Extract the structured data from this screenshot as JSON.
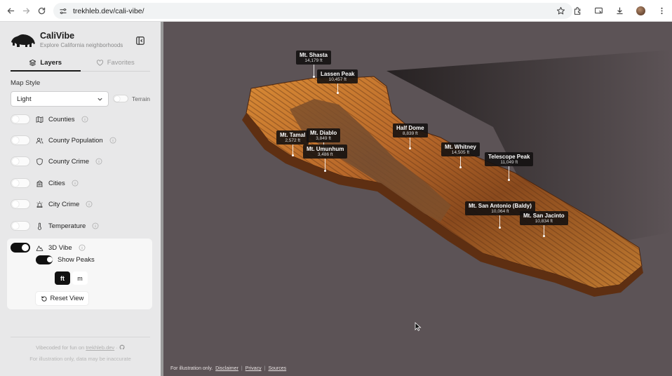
{
  "browser": {
    "url": "trekhleb.dev/cali-vibe/"
  },
  "app": {
    "title": "CaliVibe",
    "subtitle": "Explore California neighborhoods"
  },
  "tabs": [
    {
      "label": "Layers",
      "icon": "layers-icon",
      "active": true
    },
    {
      "label": "Favorites",
      "icon": "heart-icon",
      "active": false
    }
  ],
  "map_style": {
    "label": "Map Style",
    "selected": "Light",
    "terrain_label": "Terrain",
    "terrain_on": false
  },
  "layers": [
    {
      "label": "Counties",
      "icon": "map-icon",
      "on": false
    },
    {
      "label": "County Population",
      "icon": "users-icon",
      "on": false
    },
    {
      "label": "County Crime",
      "icon": "shield-icon",
      "on": false
    },
    {
      "label": "Cities",
      "icon": "building-icon",
      "on": false
    },
    {
      "label": "City Crime",
      "icon": "siren-icon",
      "on": false
    },
    {
      "label": "Temperature",
      "icon": "thermometer-icon",
      "on": false
    },
    {
      "label": "3D Vibe",
      "icon": "mountain-icon",
      "on": true
    }
  ],
  "vibe_options": {
    "show_peaks_label": "Show Peaks",
    "show_peaks_on": true,
    "unit_ft": "ft",
    "unit_m": "m",
    "selected_unit": "ft",
    "reset_label": "Reset View"
  },
  "footer": {
    "line1_prefix": "Vibecoded for fun on",
    "line1_link": "trekhleb.dev",
    "line2": "For illustration only, data may be inaccurate"
  },
  "peaks": [
    {
      "name": "Mt. Shasta",
      "elevation": "14,179 ft"
    },
    {
      "name": "Lassen Peak",
      "elevation": "10,457 ft"
    },
    {
      "name": "Half Dome",
      "elevation": "8,839 ft"
    },
    {
      "name": "Mt. Tamal",
      "elevation": "2,572 ft"
    },
    {
      "name": "Mt. Diablo",
      "elevation": "3,849 ft"
    },
    {
      "name": "Mt. Umunhum",
      "elevation": "3,486 ft"
    },
    {
      "name": "Mt. Whitney",
      "elevation": "14,505 ft"
    },
    {
      "name": "Telescope Peak",
      "elevation": "11,049 ft"
    },
    {
      "name": "Mt. San Antonio (Baldy)",
      "elevation": "10,064 ft"
    },
    {
      "name": "Mt. San Jacinto",
      "elevation": "10,834 ft"
    }
  ],
  "map_footer": {
    "note": "For illustration only.",
    "links": [
      "Disclaimer",
      "Privacy",
      "Sources"
    ]
  },
  "colors": {
    "map_background": "#5c5356",
    "terrain_high": "#e89a3a",
    "terrain_low": "#5a2e12",
    "accent": "#111111"
  }
}
